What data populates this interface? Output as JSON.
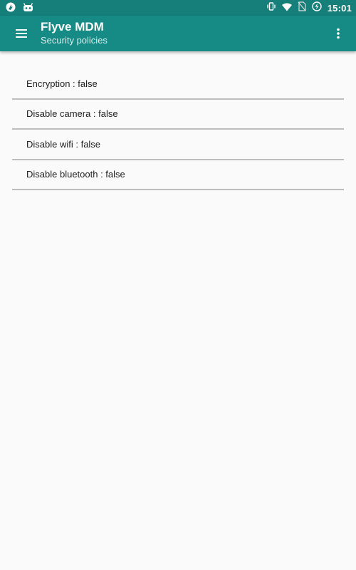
{
  "status_bar": {
    "time": "15:01",
    "left_icons": [
      "app-notification-icon",
      "android-bot-icon"
    ],
    "right_icons": [
      "vibrate-icon",
      "wifi-icon",
      "no-sim-icon",
      "battery-charging-icon"
    ]
  },
  "app_bar": {
    "title": "Flyve MDM",
    "subtitle": "Security policies",
    "color": "#168a85"
  },
  "policies": [
    {
      "label": "Encryption : false"
    },
    {
      "label": "Disable camera : false"
    },
    {
      "label": "Disable wifi : false"
    },
    {
      "label": "Disable bluetooth : false"
    }
  ]
}
